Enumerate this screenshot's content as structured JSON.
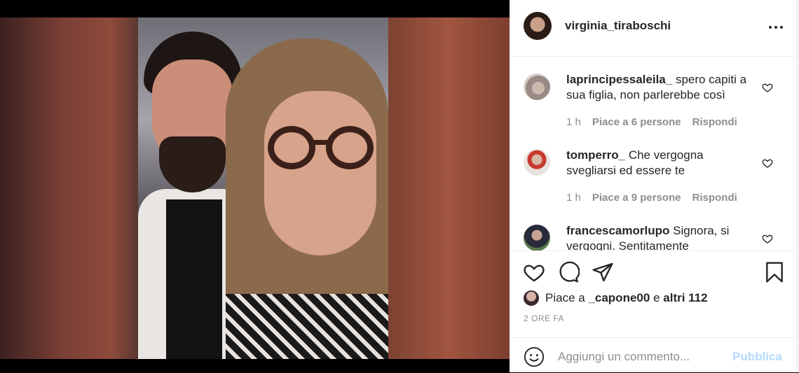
{
  "post": {
    "author": "virginia_tiraboschi",
    "time_ago": "2 ORE FA"
  },
  "comments": [
    {
      "username": "laprincipessaleila_",
      "text": "spero capiti a sua figlia, non parlerebbe così",
      "time": "1 h",
      "likes": "Piace a 6 persone",
      "reply": "Rispondi"
    },
    {
      "username": "tomperro_",
      "text": "Che vergogna svegliarsi ed essere te",
      "time": "1 h",
      "likes": "Piace a 9 persone",
      "reply": "Rispondi"
    },
    {
      "username": "francescamorlupo",
      "text": "Signora, si vergogni. Sentitamente",
      "time": "",
      "likes": "",
      "reply": ""
    }
  ],
  "likes": {
    "prefix": "Piace a",
    "user": "_capone00",
    "conjunction": "e",
    "others": "altri 112"
  },
  "comment_box": {
    "placeholder": "Aggiungi un commento...",
    "publish_label": "Pubblica"
  },
  "icons": {
    "more": "more-options-icon",
    "like": "heart-icon",
    "comment": "comment-icon",
    "share": "share-icon",
    "save": "bookmark-icon",
    "emoji": "emoji-icon"
  },
  "colors": {
    "link_disabled": "#b3dbff",
    "muted": "#8e8e8e",
    "text": "#262626"
  }
}
